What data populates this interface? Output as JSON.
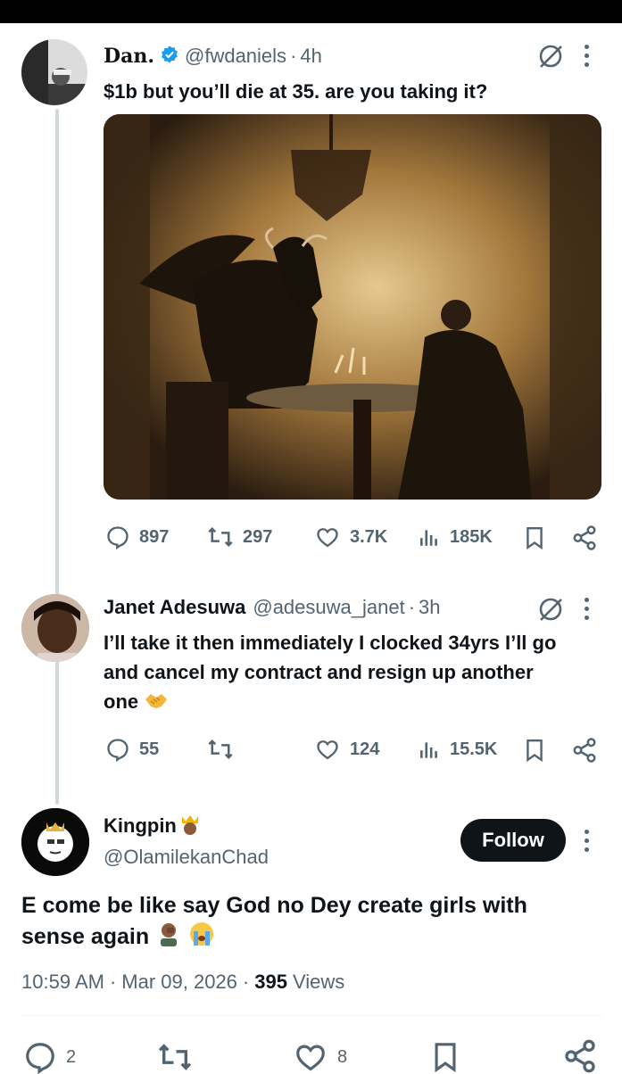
{
  "tweet1": {
    "name": "Dan.",
    "handle": "@fwdaniels",
    "time": "4h",
    "text": "$1b but you’ll die at 35. are you taking it?",
    "stats": {
      "replies": "897",
      "retweets": "297",
      "likes": "3.7K",
      "views": "185K"
    }
  },
  "tweet2": {
    "name": "Janet Adesuwa",
    "handle": "@adesuwa_janet",
    "time": "3h",
    "text_line1": "I’ll take it then immediately I clocked 34yrs I’ll go",
    "text_line2": "and cancel my contract and resign up another",
    "text_line3": "one",
    "stats": {
      "replies": "55",
      "likes": "124",
      "views": "15.5K"
    }
  },
  "main": {
    "name": "Kingpin",
    "handle": "@OlamilekanChad",
    "follow_label": "Follow",
    "text_line1": "E come be like say God no Dey create girls with",
    "text_line2": "sense again",
    "time": "10:59 AM",
    "date": "Mar 09, 2026",
    "views_count": "395",
    "views_label": "Views",
    "stats": {
      "replies": "2",
      "likes": "8"
    }
  },
  "separator": "·",
  "colors": {
    "verified": "#1d9bf0",
    "text": "#0f1419",
    "muted": "#536471"
  }
}
